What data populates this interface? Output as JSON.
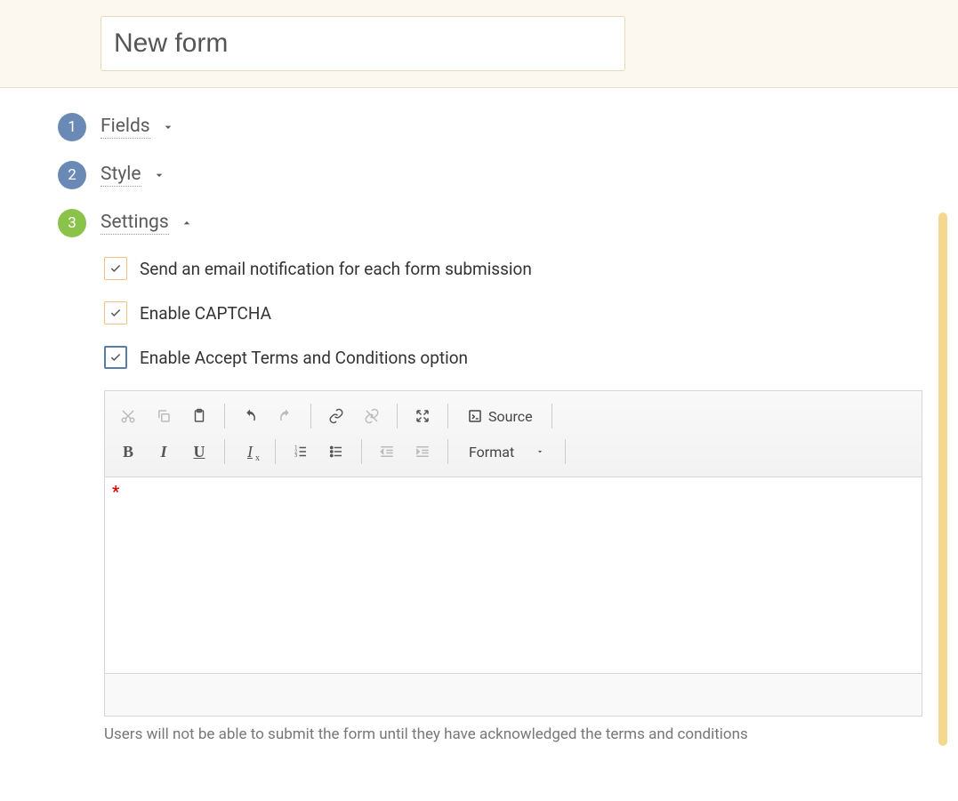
{
  "header": {
    "title_value": "New form"
  },
  "sections": {
    "fields": {
      "num": "1",
      "label": "Fields",
      "expanded": false
    },
    "style": {
      "num": "2",
      "label": "Style",
      "expanded": false
    },
    "settings": {
      "num": "3",
      "label": "Settings",
      "expanded": true
    }
  },
  "settings_panel": {
    "email_notification": {
      "label": "Send an email notification for each form submission",
      "checked": true
    },
    "enable_captcha": {
      "label": "Enable CAPTCHA",
      "checked": true
    },
    "enable_tc": {
      "label": "Enable Accept Terms and Conditions option",
      "checked": true
    },
    "editor": {
      "toolbar": {
        "source_label": "Source",
        "format_label": "Format"
      },
      "content": "*"
    },
    "help_text": "Users will not be able to submit the form until they have acknowledged the terms and conditions"
  }
}
